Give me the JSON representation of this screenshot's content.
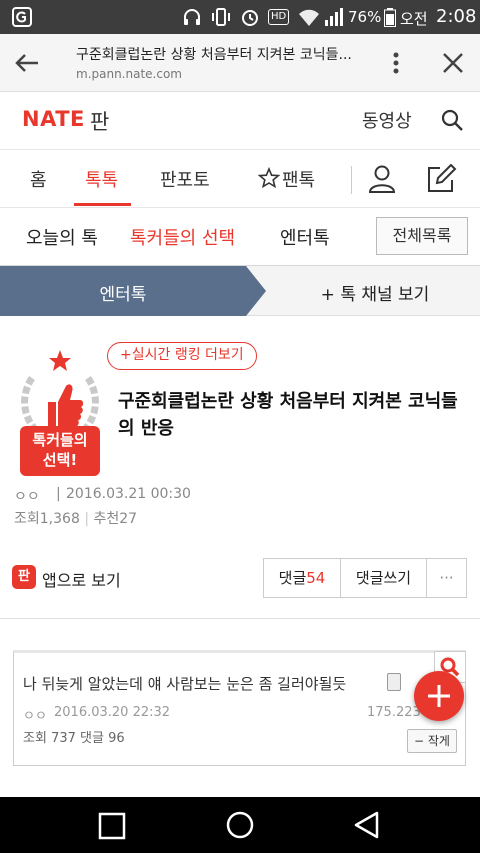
{
  "status_bar": {
    "battery": "76%",
    "ampm": "오전",
    "time": "2:08",
    "hd_label": "HD"
  },
  "browser": {
    "title": "구준회클럽논란 상황 처음부터 지켜본 코닉들...",
    "url": "m.pann.nate.com"
  },
  "site_header": {
    "logo": "NATE",
    "section": "판",
    "video": "동영상"
  },
  "main_nav": {
    "items": [
      "홈",
      "톡톡",
      "판포토",
      "팬톡"
    ],
    "active": 1
  },
  "sub_nav": {
    "items": [
      "오늘의 톡",
      "톡커들의 선택",
      "엔터톡"
    ],
    "active": 1,
    "all_button": "전체목록"
  },
  "channel_bar": {
    "current": "엔터톡",
    "more": "+ 톡 채널 보기"
  },
  "colors": {
    "accent": "#e8372d",
    "channel_active": "#5a6f8c"
  },
  "article": {
    "badge_line1": "톡커들의",
    "badge_line2": "선택!",
    "ranking_link": "+실시간 랭킹 더보기",
    "title": "구준회클럽논란 상황 처음부터 지켜본 코닉들의 반응",
    "author": "ㅇㅇ",
    "date": "2016.03.21 00:30",
    "views_label": "조회",
    "views": "1,368",
    "recommend_label": "추천",
    "recommend": "27"
  },
  "actions": {
    "app_icon_text": "판",
    "app_view": "앱으로 보기",
    "comments_label": "댓글",
    "comments_count": "54",
    "write_comment": "댓글쓰기",
    "more": "···"
  },
  "related": {
    "title": "나 뒤늦게 알았는데 얘 사람보는 눈은 좀 길러야될듯",
    "author": "ㅇㅇ",
    "date": "2016.03.20 22:32",
    "ip": "175.223",
    "views_label": "조회",
    "views": "737",
    "comments_label": "댓글",
    "comments": "96",
    "shrink": "작게"
  },
  "fab": {
    "icon": "plus-icon"
  }
}
